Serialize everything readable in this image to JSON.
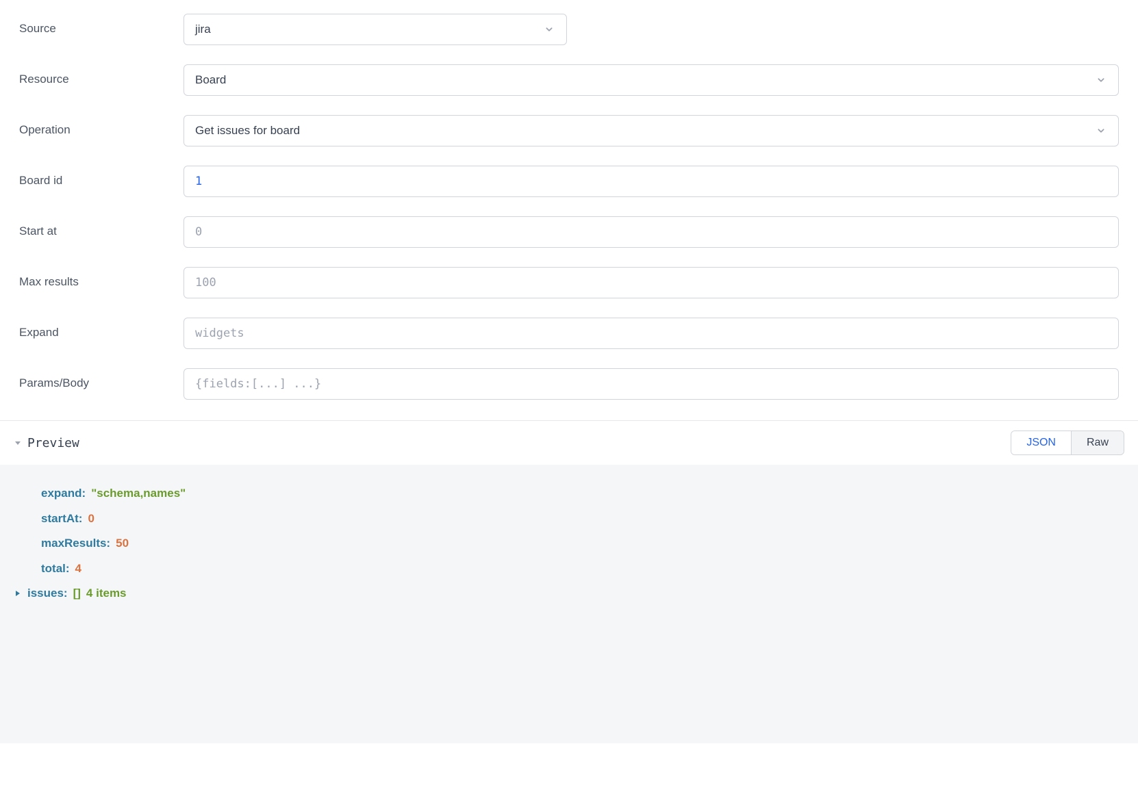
{
  "form": {
    "source": {
      "label": "Source",
      "value": "jira"
    },
    "resource": {
      "label": "Resource",
      "value": "Board"
    },
    "operation": {
      "label": "Operation",
      "value": "Get issues for board"
    },
    "boardId": {
      "label": "Board id",
      "value": "1"
    },
    "startAt": {
      "label": "Start at",
      "placeholder": "0"
    },
    "maxResults": {
      "label": "Max results",
      "placeholder": "100"
    },
    "expand": {
      "label": "Expand",
      "placeholder": "widgets"
    },
    "paramsBody": {
      "label": "Params/Body",
      "placeholder": "{fields:[...] ...}"
    }
  },
  "preview": {
    "title": "Preview",
    "toggle": {
      "json": "JSON",
      "raw": "Raw"
    },
    "data": {
      "expand": {
        "key": "expand:",
        "value": "\"schema,names\""
      },
      "startAt": {
        "key": "startAt:",
        "value": "0"
      },
      "maxResults": {
        "key": "maxResults:",
        "value": "50"
      },
      "total": {
        "key": "total:",
        "value": "4"
      },
      "issues": {
        "key": "issues:",
        "bracket": "[]",
        "count": "4 items"
      }
    }
  }
}
